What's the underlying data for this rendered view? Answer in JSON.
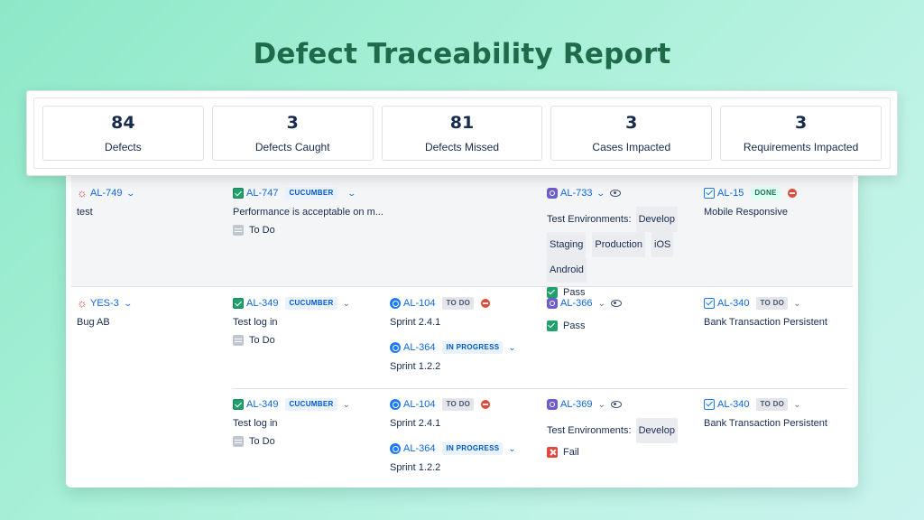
{
  "page": {
    "title": "Defect Traceability Report"
  },
  "stats": [
    {
      "value": "84",
      "label": "Defects"
    },
    {
      "value": "3",
      "label": "Defects Caught"
    },
    {
      "value": "81",
      "label": "Defects Missed"
    },
    {
      "value": "3",
      "label": "Cases Impacted"
    },
    {
      "value": "3",
      "label": "Requirements Impacted"
    }
  ],
  "rows": [
    {
      "defect": {
        "key": "AL-749",
        "summary": "test"
      },
      "cases": [
        {
          "test_case": {
            "key": "AL-747",
            "badge": "CUCUMBER",
            "summary": "Performance is acceptable on m...",
            "status": "To Do"
          },
          "plans": [],
          "execution": {
            "key": "AL-733",
            "env_label": "Test Environments:",
            "envs": [
              "Develop",
              "Staging",
              "Production",
              "iOS",
              "Android"
            ],
            "result": "Pass"
          },
          "requirement": {
            "key": "AL-15",
            "badge": "DONE",
            "summary": "Mobile Responsive"
          }
        }
      ]
    },
    {
      "defect": {
        "key": "YES-3",
        "summary": "Bug AB"
      },
      "cases": [
        {
          "test_case": {
            "key": "AL-349",
            "badge": "CUCUMBER",
            "summary": "Test log in",
            "status": "To Do"
          },
          "plans": [
            {
              "key": "AL-104",
              "badge": "TO DO",
              "summary": "Sprint 2.4.1"
            },
            {
              "key": "AL-364",
              "badge": "IN PROGRESS",
              "summary": "Sprint 1.2.2"
            }
          ],
          "execution": {
            "key": "AL-366",
            "result": "Pass"
          },
          "requirement": {
            "key": "AL-340",
            "badge": "TO DO",
            "summary": "Bank Transaction Persistent"
          }
        },
        {
          "test_case": {
            "key": "AL-349",
            "badge": "CUCUMBER",
            "summary": "Test log in",
            "status": "To Do"
          },
          "plans": [
            {
              "key": "AL-104",
              "badge": "TO DO",
              "summary": "Sprint 2.4.1"
            },
            {
              "key": "AL-364",
              "badge": "IN PROGRESS",
              "summary": "Sprint 1.2.2"
            }
          ],
          "execution": {
            "key": "AL-369",
            "env_label": "Test Environments:",
            "envs": [
              "Develop"
            ],
            "result": "Fail"
          },
          "requirement": {
            "key": "AL-340",
            "badge": "TO DO",
            "summary": "Bank Transaction Persistent"
          }
        }
      ]
    }
  ],
  "colors": {
    "title": "#1e6a4a",
    "link": "#0c66e4",
    "pass": "#22a06b",
    "fail": "#e2483d"
  },
  "icons": {
    "defect": "bug-icon",
    "test_case": "test-case-icon",
    "plan": "test-plan-icon",
    "execution": "test-execution-icon",
    "requirement": "story-icon"
  }
}
